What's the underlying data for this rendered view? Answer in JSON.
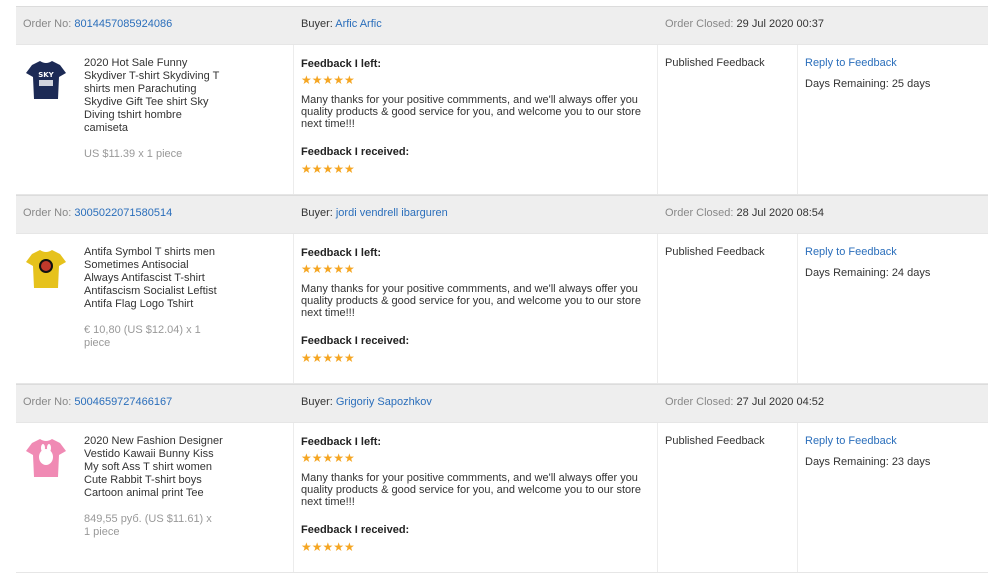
{
  "orders": [
    {
      "order_no_label": "Order No:",
      "order_no": "8014457085924086",
      "buyer_label": "Buyer:",
      "buyer": "Arfic Arfic",
      "closed_label": "Order Closed:",
      "closed": "29 Jul 2020 00:37",
      "product_title": "2020 Hot Sale Funny Skydiver T-shirt Skydiving T shirts men Parachuting Skydive Gift Tee shirt Sky Diving tshirt hombre camiseta",
      "price": "US $11.39 x 1 piece",
      "image_color": "#1c2a55",
      "image_text": "SKY",
      "fb_left_label": "Feedback I left:",
      "fb_left_stars": "★★★★★",
      "fb_left_text": "Many thanks for your positive commments, and we'll always offer you quality products & good service for you, and welcome you to our store next time!!!",
      "fb_received_label": "Feedback I received:",
      "fb_received_stars": "★★★★★",
      "status": "Published Feedback",
      "reply": "Reply to Feedback",
      "days": "Days Remaining: 25 days"
    },
    {
      "order_no_label": "Order No:",
      "order_no": "3005022071580514",
      "buyer_label": "Buyer:",
      "buyer": "jordi vendrell ibarguren",
      "closed_label": "Order Closed:",
      "closed": "28 Jul 2020 08:54",
      "product_title": "Antifa Symbol T shirts men Sometimes Antisocial Always Antifascist T-shirt Antifascism Socialist Leftist Antifa Flag Logo Tshirt",
      "price": "€ 10,80 (US $12.04) x 1 piece",
      "image_color": "#e6c21c",
      "image_text": "",
      "fb_left_label": "Feedback I left:",
      "fb_left_stars": "★★★★★",
      "fb_left_text": "Many thanks for your positive commments, and we'll always offer you quality products & good service for you, and welcome you to our store next time!!!",
      "fb_received_label": "Feedback I received:",
      "fb_received_stars": "★★★★★",
      "status": "Published Feedback",
      "reply": "Reply to Feedback",
      "days": "Days Remaining: 24 days"
    },
    {
      "order_no_label": "Order No:",
      "order_no": "5004659727466167",
      "buyer_label": "Buyer:",
      "buyer": "Grigoriy Sapozhkov",
      "closed_label": "Order Closed:",
      "closed": "27 Jul 2020 04:52",
      "product_title": "2020 New Fashion Designer Vestido Kawaii Bunny Kiss My soft Ass T shirt women Cute Rabbit T-shirt boys Cartoon animal print Tee",
      "price": "849,55 руб. (US $11.61) x 1 piece",
      "image_color": "#f08ab4",
      "image_text": "",
      "fb_left_label": "Feedback I left:",
      "fb_left_stars": "★★★★★",
      "fb_left_text": "Many thanks for your positive commments, and we'll always offer you quality products & good service for you, and welcome you to our store next time!!!",
      "fb_received_label": "Feedback I received:",
      "fb_received_stars": "★★★★★",
      "status": "Published Feedback",
      "reply": "Reply to Feedback",
      "days": "Days Remaining: 23 days"
    }
  ]
}
